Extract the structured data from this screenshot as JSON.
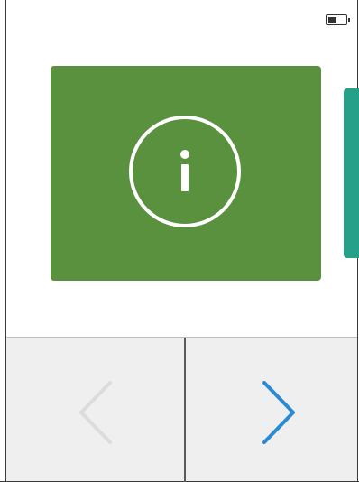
{
  "status_bar": {
    "battery_icon": "battery-half-icon",
    "battery_level": 0.5
  },
  "carousel": {
    "cards": [
      {
        "name": "info",
        "icon": "info-icon",
        "color": "#5a913f"
      },
      {
        "name": "next-peek",
        "color": "#27a08a"
      }
    ]
  },
  "navigation": {
    "prev": {
      "icon": "chevron-left-icon",
      "enabled": false,
      "color": "#dcdcdc"
    },
    "next": {
      "icon": "chevron-right-icon",
      "enabled": true,
      "color": "#2a8ad4"
    }
  }
}
